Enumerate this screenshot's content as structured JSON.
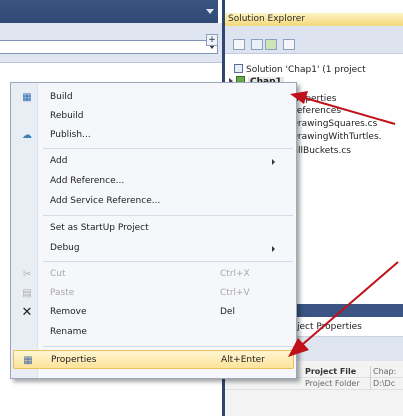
{
  "solution_explorer": {
    "title": "Solution Explorer",
    "solution_label": "Solution 'Chap1' (1 project",
    "project_label": "Chap1",
    "items": [
      {
        "label": "Properties"
      },
      {
        "label": "References"
      },
      {
        "label": "DrawingSquares.cs"
      },
      {
        "label": "DrawingWithTurtles."
      },
      {
        "label": "FillBuckets.cs"
      }
    ]
  },
  "properties_pane": {
    "header": "ject Properties",
    "rows": [
      {
        "key": "Project File",
        "value": "Chap:"
      },
      {
        "key": "Project Folder",
        "value": "D:\\Dc"
      }
    ]
  },
  "context_menu": {
    "items": [
      {
        "label": "Build",
        "icon": "build-icon"
      },
      {
        "label": "Rebuild"
      },
      {
        "label": "Publish...",
        "icon": "publish-icon"
      },
      {
        "label": "Add",
        "submenu": true
      },
      {
        "label": "Add Reference..."
      },
      {
        "label": "Add Service Reference..."
      },
      {
        "label": "Set as StartUp Project"
      },
      {
        "label": "Debug",
        "submenu": true
      },
      {
        "label": "Cut",
        "shortcut": "Ctrl+X",
        "disabled": true,
        "icon": "cut-icon"
      },
      {
        "label": "Paste",
        "shortcut": "Ctrl+V",
        "disabled": true,
        "icon": "paste-icon"
      },
      {
        "label": "Remove",
        "shortcut": "Del",
        "icon": "remove-icon"
      },
      {
        "label": "Rename"
      },
      {
        "label": "Properties",
        "shortcut": "Alt+Enter",
        "icon": "properties-icon",
        "highlighted": true
      }
    ]
  },
  "annotation_color": "#c0101a",
  "colors": {
    "titlebar": "#2f4a75",
    "se_title": "#f4d87a",
    "highlight": "#fde39a"
  }
}
